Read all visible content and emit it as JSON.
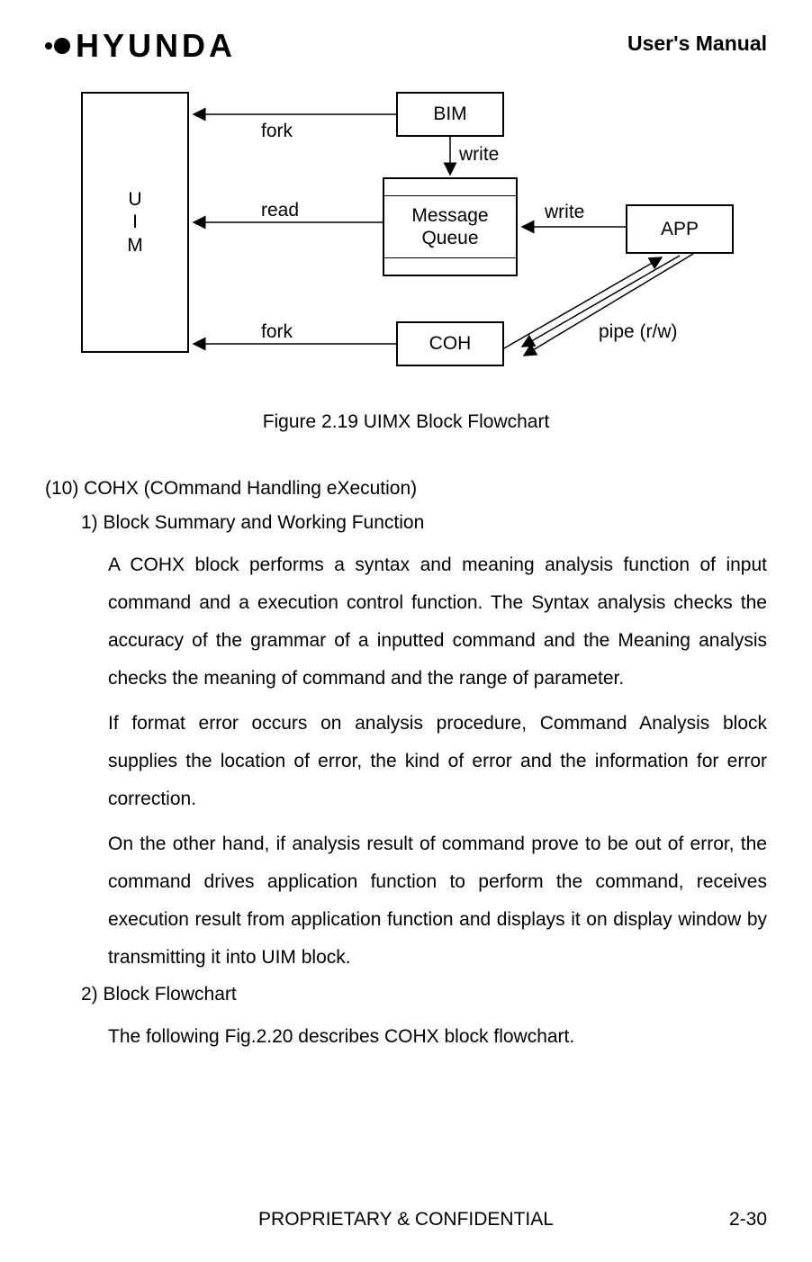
{
  "header": {
    "logo_text": "HYUNDA",
    "right": "User's Manual"
  },
  "diagram": {
    "uim_1": "U",
    "uim_2": "I",
    "uim_3": "M",
    "bim": "BIM",
    "mq_1": "Message",
    "mq_2": "Queue",
    "coh": "COH",
    "app": "APP",
    "label_fork1": "fork",
    "label_fork2": "fork",
    "label_read": "read",
    "label_write1": "write",
    "label_write2": "write",
    "label_pipe": "pipe (r/w)"
  },
  "figure_caption": "Figure 2.19 UIMX Block Flowchart",
  "content": {
    "section_title": "(10) COHX (COmmand Handling eXecution)",
    "sub1_title": "1) Block Summary and Working Function",
    "para1": "A COHX block performs a syntax and meaning analysis function of input command and a execution control function. The Syntax analysis checks the accuracy of the grammar of a inputted command and the Meaning analysis checks the meaning of command and the range of parameter.",
    "para2": "If format error occurs on analysis procedure, Command Analysis block supplies the location of error, the kind of error and the information for error correction.",
    "para3": "On the other hand, if analysis result of command prove to be out of error, the command drives application function to perform the command, receives execution result from application function and displays it on display window by transmitting it into UIM block.",
    "sub2_title": "2) Block Flowchart",
    "para4": "The following Fig.2.20 describes COHX block flowchart."
  },
  "footer": {
    "center": "PROPRIETARY & CONFIDENTIAL",
    "right": "2-30"
  }
}
